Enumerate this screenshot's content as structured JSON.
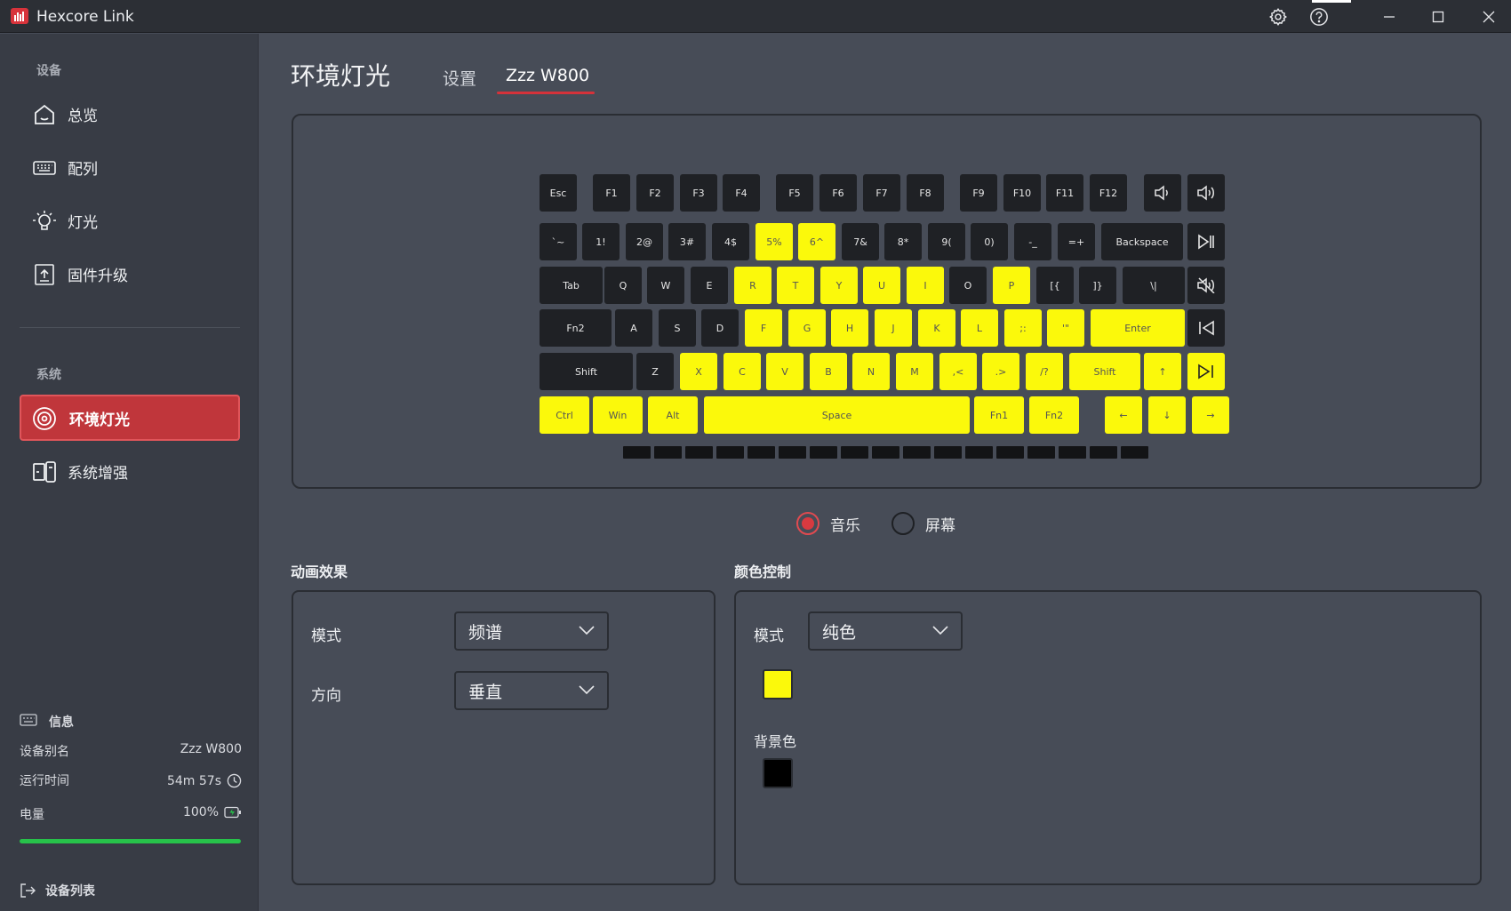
{
  "app": {
    "title": "Hexcore Link"
  },
  "colors": {
    "accent": "#c0363b",
    "key_lit": "#fbf90b",
    "key_dark": "#1f2125",
    "battery": "#27c24a"
  },
  "sidebar": {
    "devices_label": "设备",
    "items": [
      {
        "label": "总览",
        "icon": "home-icon"
      },
      {
        "label": "配列",
        "icon": "keyboard-icon"
      },
      {
        "label": "灯光",
        "icon": "bulb-icon"
      },
      {
        "label": "固件升级",
        "icon": "upload-icon"
      }
    ],
    "system_label": "系统",
    "system_items": [
      {
        "label": "环境灯光",
        "icon": "ambient-icon",
        "active": true
      },
      {
        "label": "系统增强",
        "icon": "devices-icon"
      }
    ],
    "info": {
      "title": "信息",
      "alias_label": "设备别名",
      "alias": "Zzz W800",
      "uptime_label": "运行时间",
      "uptime": "54m 57s",
      "battery_label": "电量",
      "battery": "100%",
      "battery_level": 1.0
    },
    "device_list": "设备列表"
  },
  "main": {
    "title": "环境灯光",
    "tabs": [
      {
        "label": "设置",
        "active": false
      },
      {
        "label": "Zzz W800",
        "active": true
      }
    ],
    "keyboard": {
      "rows": [
        [
          [
            "Esc",
            0
          ],
          [
            "F1",
            0
          ],
          [
            "F2",
            0
          ],
          [
            "F3",
            0
          ],
          [
            "F4",
            0
          ],
          [
            "F5",
            0
          ],
          [
            "F6",
            0
          ],
          [
            "F7",
            0
          ],
          [
            "F8",
            0
          ],
          [
            "F9",
            0
          ],
          [
            "F10",
            0
          ],
          [
            "F11",
            0
          ],
          [
            "F12",
            0
          ],
          [
            "vol-down",
            0
          ],
          [
            "vol-up",
            0
          ]
        ],
        [
          [
            "`~",
            0
          ],
          [
            "1!",
            0
          ],
          [
            "2@",
            0
          ],
          [
            "3#",
            0
          ],
          [
            "4$",
            0
          ],
          [
            "5%",
            1
          ],
          [
            "6^",
            1
          ],
          [
            "7&",
            0
          ],
          [
            "8*",
            0
          ],
          [
            "9(",
            0
          ],
          [
            "0)",
            0
          ],
          [
            "-_",
            0
          ],
          [
            "=+",
            0
          ],
          [
            "Backspace",
            0
          ],
          [
            "play-pause",
            0
          ]
        ],
        [
          [
            "Tab",
            0
          ],
          [
            "Q",
            0
          ],
          [
            "W",
            0
          ],
          [
            "E",
            0
          ],
          [
            "R",
            1
          ],
          [
            "T",
            1
          ],
          [
            "Y",
            1
          ],
          [
            "U",
            1
          ],
          [
            "I",
            1
          ],
          [
            "O",
            0
          ],
          [
            "P",
            1
          ],
          [
            "[{",
            0
          ],
          [
            "]}",
            0
          ],
          [
            "\\|",
            0
          ],
          [
            "mute",
            0
          ]
        ],
        [
          [
            "Fn2",
            0
          ],
          [
            "A",
            0
          ],
          [
            "S",
            0
          ],
          [
            "D",
            0
          ],
          [
            "F",
            1
          ],
          [
            "G",
            1
          ],
          [
            "H",
            1
          ],
          [
            "J",
            1
          ],
          [
            "K",
            1
          ],
          [
            "L",
            1
          ],
          [
            ";:",
            1
          ],
          [
            "'\"",
            1
          ],
          [
            "Enter",
            1
          ],
          [
            "prev",
            0
          ]
        ],
        [
          [
            "Shift",
            0
          ],
          [
            "Z",
            0
          ],
          [
            "X",
            1
          ],
          [
            "C",
            1
          ],
          [
            "V",
            1
          ],
          [
            "B",
            1
          ],
          [
            "N",
            1
          ],
          [
            "M",
            1
          ],
          [
            ",<",
            1
          ],
          [
            ".>",
            1
          ],
          [
            "/?",
            1
          ],
          [
            "Shift",
            1
          ],
          [
            "↑",
            1
          ],
          [
            "next",
            1
          ]
        ],
        [
          [
            "Ctrl",
            1
          ],
          [
            "Win",
            1
          ],
          [
            "Alt",
            1
          ],
          [
            "Space",
            1
          ],
          [
            "Fn1",
            1
          ],
          [
            "Fn2",
            1
          ],
          [
            "←",
            1
          ],
          [
            "↓",
            1
          ],
          [
            "→",
            1
          ]
        ]
      ]
    },
    "source": {
      "music": "音乐",
      "screen": "屏幕",
      "selected": "music"
    },
    "animation": {
      "title": "动画效果",
      "mode_label": "模式",
      "mode": "频谱",
      "direction_label": "方向",
      "direction": "垂直"
    },
    "color": {
      "title": "颜色控制",
      "mode_label": "模式",
      "mode": "纯色",
      "fg_color": "#fbf90b",
      "bg_label": "背景色",
      "bg_color": "#000000"
    }
  }
}
